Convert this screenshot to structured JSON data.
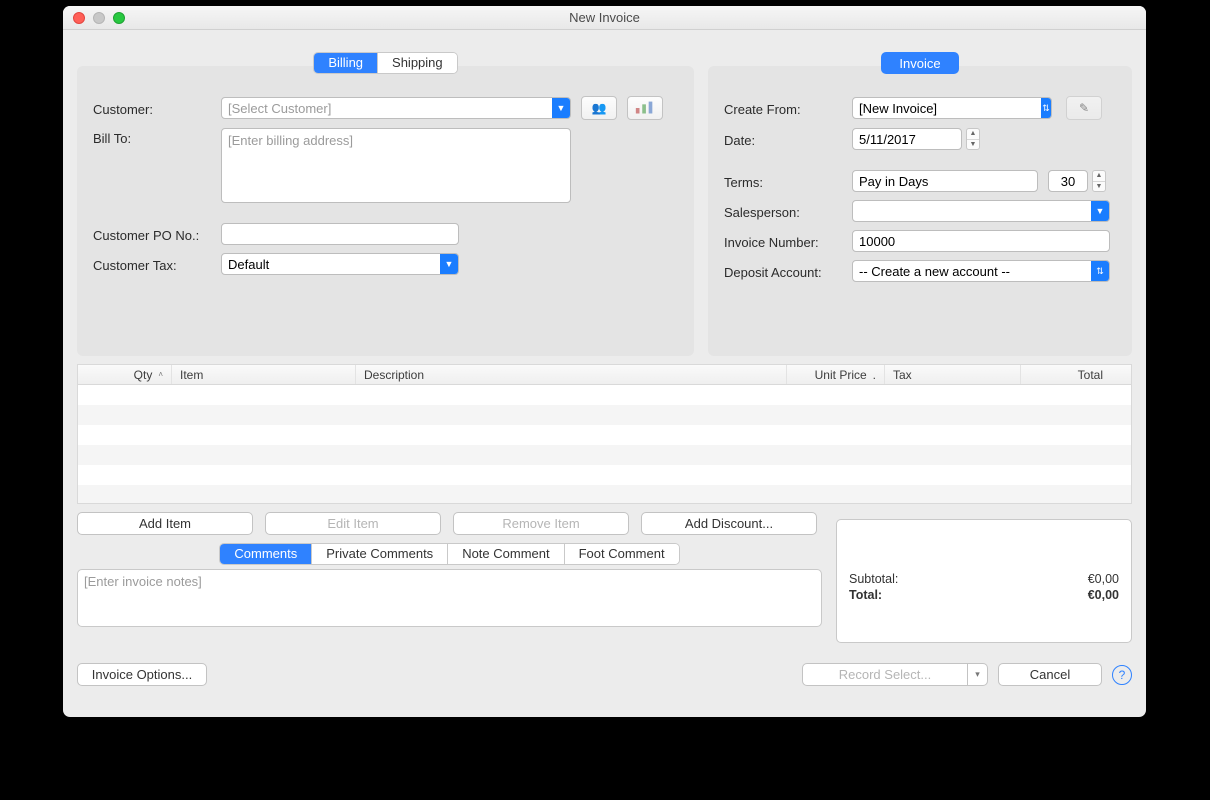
{
  "window": {
    "title": "New Invoice"
  },
  "billing": {
    "tabs": {
      "billing": "Billing",
      "shipping": "Shipping"
    },
    "labels": {
      "customer": "Customer:",
      "bill_to": "Bill To:",
      "po": "Customer PO No.:",
      "tax": "Customer Tax:"
    },
    "customer_placeholder": "[Select Customer]",
    "bill_to_placeholder": "[Enter billing address]",
    "po_value": "",
    "tax_value": "Default"
  },
  "invoice": {
    "heading": "Invoice",
    "labels": {
      "create_from": "Create From:",
      "date": "Date:",
      "terms": "Terms:",
      "salesperson": "Salesperson:",
      "number": "Invoice Number:",
      "deposit": "Deposit Account:"
    },
    "create_from": "[New Invoice]",
    "date": "5/11/2017",
    "terms": "Pay in Days",
    "terms_days": "30",
    "salesperson": "",
    "number": "10000",
    "deposit": "-- Create a new account --"
  },
  "grid": {
    "headers": {
      "qty": "Qty",
      "item": "Item",
      "desc": "Description",
      "unit": "Unit Price",
      "tax": "Tax",
      "total": "Total"
    }
  },
  "actions": {
    "add_item": "Add Item",
    "edit_item": "Edit Item",
    "remove_item": "Remove Item",
    "add_discount": "Add Discount..."
  },
  "notes": {
    "tabs": {
      "comments": "Comments",
      "private": "Private Comments",
      "note": "Note Comment",
      "foot": "Foot Comment"
    },
    "placeholder": "[Enter invoice notes]"
  },
  "totals": {
    "subtotal_label": "Subtotal:",
    "subtotal_value": "€0,00",
    "total_label": "Total:",
    "total_value": "€0,00"
  },
  "footer": {
    "options": "Invoice Options...",
    "record": "Record Select...",
    "cancel": "Cancel"
  }
}
